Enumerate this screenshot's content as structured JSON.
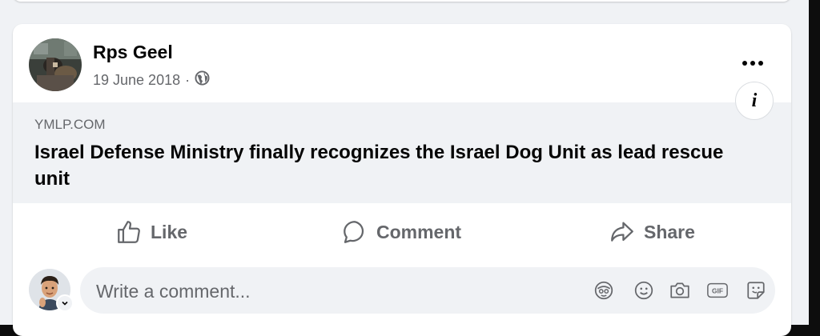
{
  "post": {
    "author": "Rps Geel",
    "date": "19 June 2018",
    "separator": "·",
    "privacy_icon": "globe-icon",
    "more_icon": "more-options-icon"
  },
  "link_preview": {
    "domain": "YMLP.COM",
    "headline": "Israel Defense Ministry finally recognizes the Israel Dog Unit as lead rescue unit",
    "info_icon": "info-icon",
    "info_glyph": "i"
  },
  "actions": {
    "like": "Like",
    "comment": "Comment",
    "share": "Share"
  },
  "comment_composer": {
    "placeholder": "Write a comment...",
    "icons": [
      "avatar-sticker-icon",
      "emoji-icon",
      "camera-icon",
      "gif-icon",
      "sticker-icon"
    ],
    "gif_label": "GIF"
  },
  "colors": {
    "text_primary": "#050505",
    "text_secondary": "#65676b",
    "feed_background": "#f0f2f5",
    "card_background": "#ffffff"
  }
}
